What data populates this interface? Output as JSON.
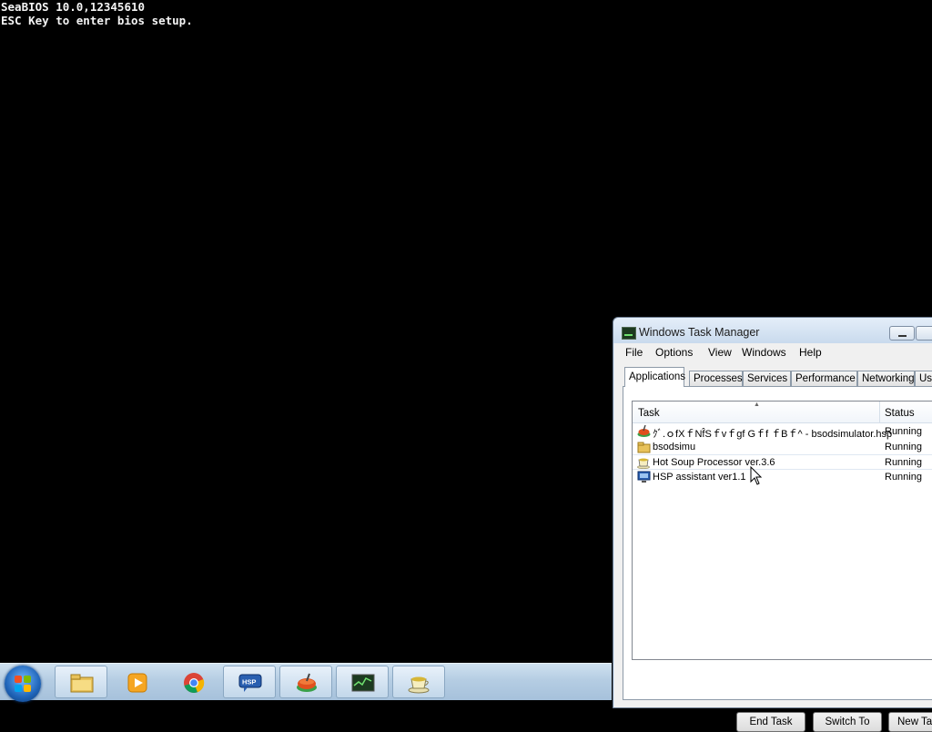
{
  "bios": {
    "line1": "SeaBIOS 10.0,12345610",
    "line2": "ESC Key to enter bios setup."
  },
  "taskbar": {
    "start_icon": "windows-start-orb",
    "items": [
      {
        "name": "folder-explorer-icon"
      },
      {
        "name": "media-player-icon"
      },
      {
        "name": "chrome-icon"
      },
      {
        "name": "hsp-assistant-icon"
      },
      {
        "name": "bsod-simulator-icon"
      },
      {
        "name": "task-manager-icon"
      },
      {
        "name": "hot-soup-processor-icon"
      }
    ]
  },
  "task_manager": {
    "title": "Windows Task Manager",
    "menu": [
      "File",
      "Options",
      "View",
      "Windows",
      "Help"
    ],
    "tabs": [
      "Applications",
      "Processes",
      "Services",
      "Performance",
      "Networking",
      "Us"
    ],
    "columns": {
      "task": "Task",
      "status": "Status"
    },
    "rows": [
      {
        "task": "ｸﾞ.ｏfXｆNf̂Sｆvｆgf Gｆf ｆBｆ^ - bsodsimulator.hsp",
        "status": "Running"
      },
      {
        "task": "bsodsimu",
        "status": "Running"
      },
      {
        "task": "Hot Soup Processor ver.3.6",
        "status": "Running"
      },
      {
        "task": "HSP assistant ver1.1",
        "status": "Running"
      }
    ],
    "buttons": {
      "end_task": "End Task",
      "switch_to": "Switch To",
      "new_task": "New Tas"
    }
  },
  "colors": {
    "accent": "#1f64b8",
    "taskbar": "#b5cde3",
    "window_frame": "#dfe9f5"
  }
}
